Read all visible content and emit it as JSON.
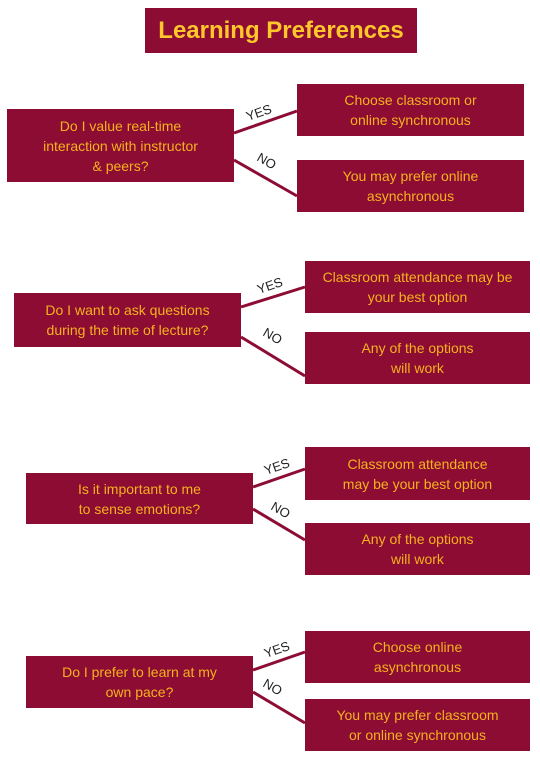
{
  "title": "Learning Preferences",
  "colors": {
    "box": "#8c0c33",
    "text": "#f5b21e",
    "title_text": "#ffc72c",
    "line": "#8c0c33"
  },
  "edge_labels": {
    "yes": "YES",
    "no": "NO"
  },
  "questions": [
    {
      "question": "Do I value real-time\ninteraction with instructor\n& peers?",
      "yes": "Choose classroom or\nonline synchronous",
      "no": "You may prefer online\nasynchronous"
    },
    {
      "question": "Do I want to ask questions\nduring the time of lecture?",
      "yes": "Classroom attendance may be\nyour best option",
      "no": "Any of the options\nwill work"
    },
    {
      "question": "Is it important to me\nto sense emotions?",
      "yes": "Classroom attendance\nmay be your best option",
      "no": "Any of the options\nwill work"
    },
    {
      "question": "Do I prefer to learn at my\nown pace?",
      "yes": "Choose online\nasynchronous",
      "no": "You may prefer classroom\nor online synchronous"
    }
  ]
}
